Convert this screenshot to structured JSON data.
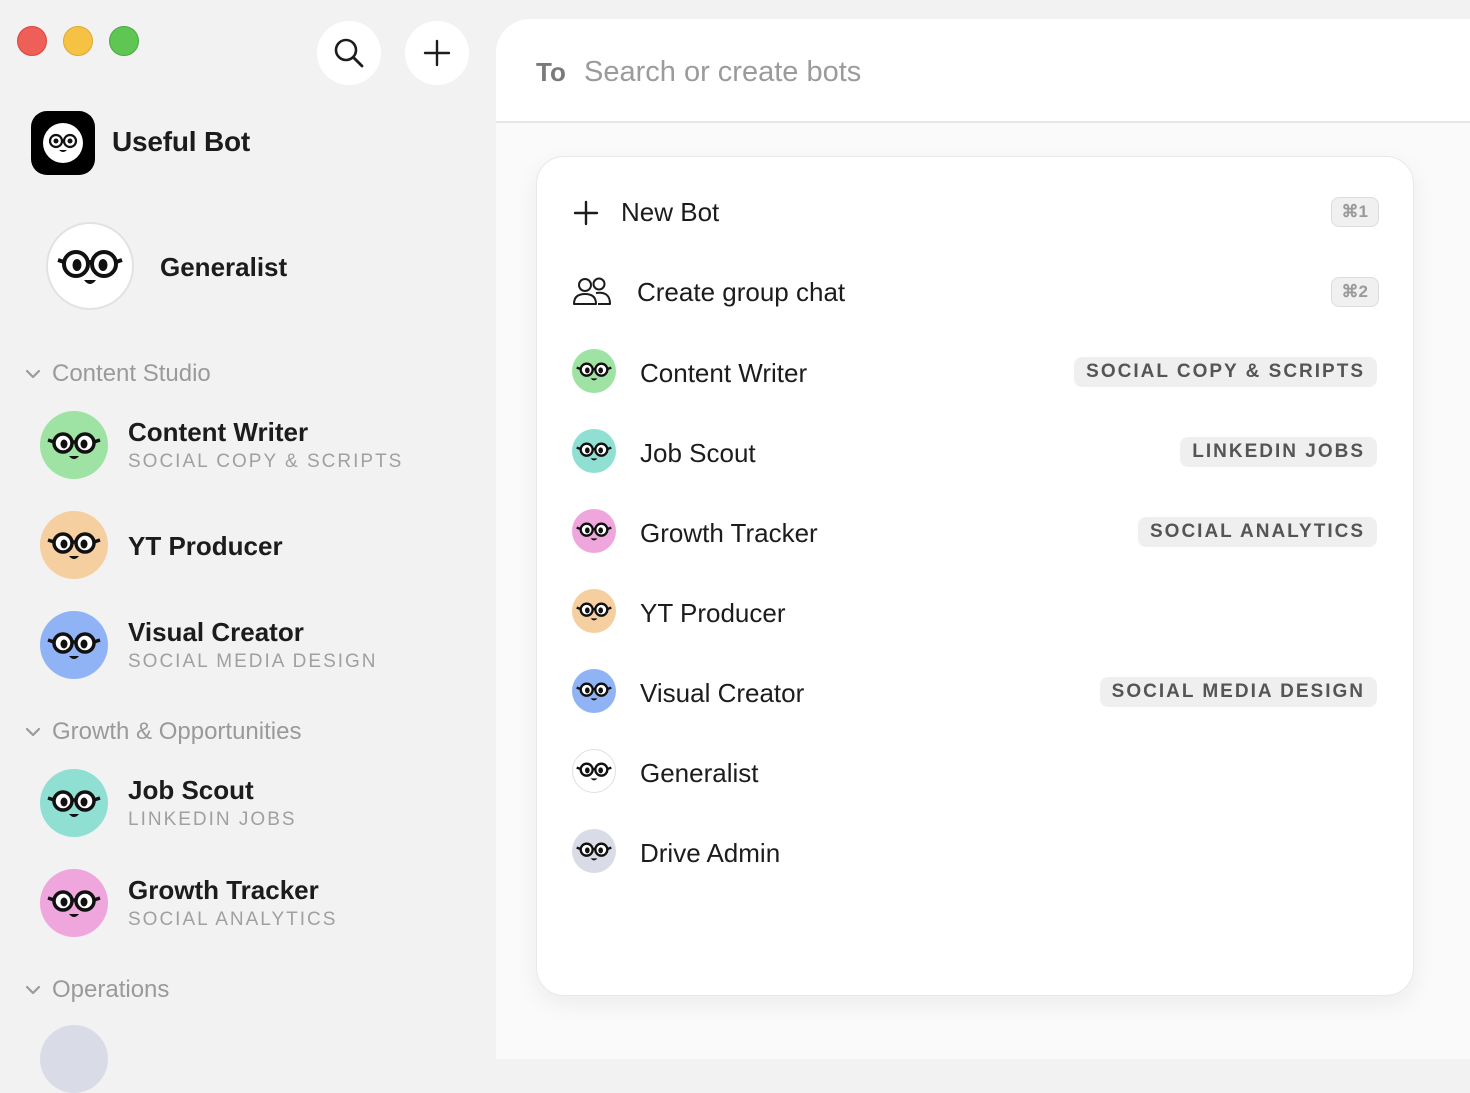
{
  "app": {
    "brand_name": "Useful Bot",
    "buttons": {
      "search_icon": "search-icon",
      "add_icon": "plus-icon"
    }
  },
  "sidebar": {
    "pinned": {
      "name": "Generalist"
    },
    "sections": [
      {
        "title": "Content Studio",
        "items": [
          {
            "name": "Content Writer",
            "subtitle": "SOCIAL COPY & SCRIPTS",
            "color": "#9ee3a3"
          },
          {
            "name": "YT Producer",
            "subtitle": "",
            "color": "#f6cfa0"
          },
          {
            "name": "Visual Creator",
            "subtitle": "SOCIAL MEDIA DESIGN",
            "color": "#90b3f5"
          }
        ]
      },
      {
        "title": "Growth & Opportunities",
        "items": [
          {
            "name": "Job Scout",
            "subtitle": "LINKEDIN JOBS",
            "color": "#8fe0d3"
          },
          {
            "name": "Growth Tracker",
            "subtitle": "SOCIAL ANALYTICS",
            "color": "#efa6dd"
          }
        ]
      },
      {
        "title": "Operations",
        "items": []
      }
    ]
  },
  "main": {
    "to_label": "To",
    "search_placeholder": "Search or create bots"
  },
  "dropdown": {
    "actions": [
      {
        "label": "New Bot",
        "shortcut": "⌘1",
        "icon": "plus-icon"
      },
      {
        "label": "Create group chat",
        "shortcut": "⌘2",
        "icon": "people-icon"
      }
    ],
    "bots": [
      {
        "name": "Content Writer",
        "tag": "SOCIAL COPY & SCRIPTS",
        "color": "#9ee3a3"
      },
      {
        "name": "Job Scout",
        "tag": "LINKEDIN JOBS",
        "color": "#8fe0d3"
      },
      {
        "name": "Growth Tracker",
        "tag": "SOCIAL ANALYTICS",
        "color": "#efa6dd"
      },
      {
        "name": "YT Producer",
        "tag": "",
        "color": "#f6cfa0"
      },
      {
        "name": "Visual Creator",
        "tag": "SOCIAL MEDIA DESIGN",
        "color": "#90b3f5"
      },
      {
        "name": "Generalist",
        "tag": "",
        "color": "#ffffff"
      },
      {
        "name": "Drive Admin",
        "tag": "",
        "color": "#d9dce6"
      }
    ]
  }
}
